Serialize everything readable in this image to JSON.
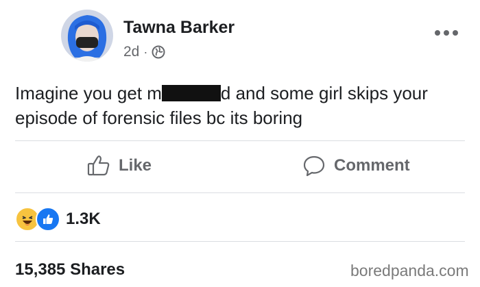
{
  "post": {
    "author": "Tawna Barker",
    "time": "2d",
    "separator": "·",
    "privacy_icon": "globe-icon",
    "text_before": "Imagine you get m",
    "text_after": "d and some girl skips your episode of forensic files bc its boring"
  },
  "actions": {
    "like_label": "Like",
    "comment_label": "Comment"
  },
  "reactions": {
    "icons": [
      "laughing-emoji-icon",
      "like-reaction-icon"
    ],
    "count": "1.3K"
  },
  "shares": "15,385 Shares",
  "watermark": "boredpanda.com",
  "colors": {
    "text": "#1c1e21",
    "muted": "#65676b",
    "like_blue": "#1877f2",
    "haha_yellow": "#f7c33f"
  }
}
